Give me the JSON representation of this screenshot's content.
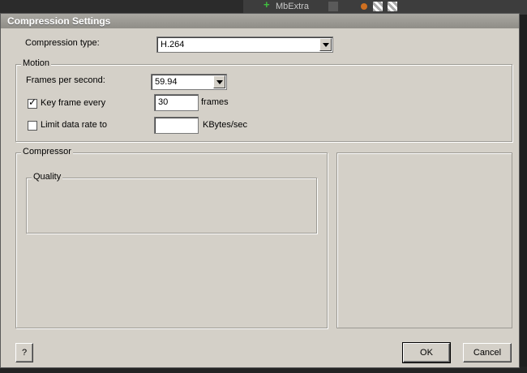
{
  "background": {
    "item_text": "MbExtra",
    "accent_green": "#3fbf3f"
  },
  "dialog": {
    "title": "Compression Settings",
    "compression_type_label": "Compression type:",
    "compression_type_value": "H.264"
  },
  "motion": {
    "group_label": "Motion",
    "fps_label": "Frames per second:",
    "fps_value": "59.94",
    "keyframe_label": "Key frame every",
    "keyframe_checked": true,
    "keyframe_check_glyph": "✓",
    "keyframe_value": "30",
    "keyframe_unit": "frames",
    "datarate_label": "Limit data rate to",
    "datarate_checked": false,
    "datarate_value": "",
    "datarate_unit": "KBytes/sec"
  },
  "compressor": {
    "group_label": "Compressor",
    "quality_label": "Quality"
  },
  "buttons": {
    "help": "?",
    "ok": "OK",
    "cancel": "Cancel"
  }
}
